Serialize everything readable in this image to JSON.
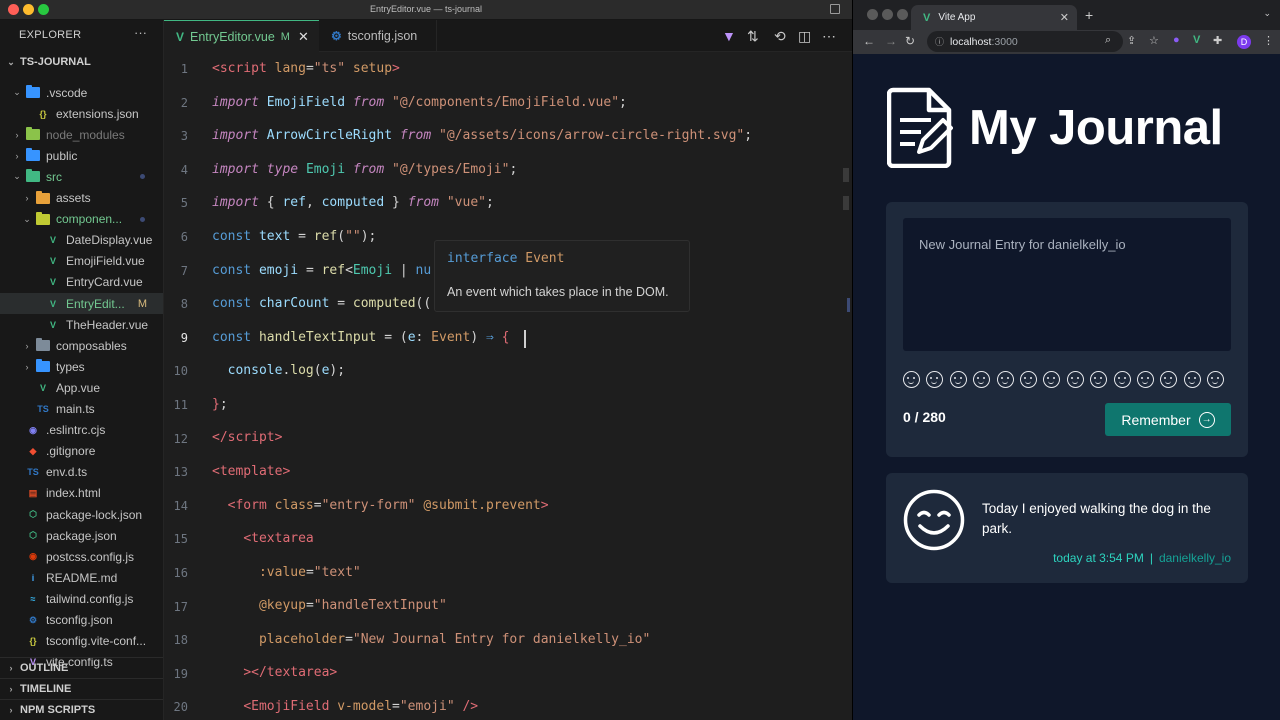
{
  "vscode": {
    "window_title": "EntryEditor.vue — ts-journal",
    "explorer": {
      "header": "EXPLORER",
      "more": "···",
      "project": "TS-JOURNAL",
      "items": [
        {
          "label": ".vscode",
          "type": "folder",
          "open": true
        },
        {
          "label": "extensions.json",
          "type": "json"
        },
        {
          "label": "node_modules",
          "type": "folder"
        },
        {
          "label": "public",
          "type": "folder"
        },
        {
          "label": "src",
          "type": "folder",
          "open": true
        },
        {
          "label": "assets",
          "type": "folder"
        },
        {
          "label": "componen...",
          "type": "folder",
          "open": true
        },
        {
          "label": "DateDisplay.vue",
          "type": "vue"
        },
        {
          "label": "EmojiField.vue",
          "type": "vue"
        },
        {
          "label": "EntryCard.vue",
          "type": "vue"
        },
        {
          "label": "EntryEdit...",
          "type": "vue",
          "badge": "M"
        },
        {
          "label": "TheHeader.vue",
          "type": "vue"
        },
        {
          "label": "composables",
          "type": "folder"
        },
        {
          "label": "types",
          "type": "folder"
        },
        {
          "label": "App.vue",
          "type": "vue"
        },
        {
          "label": "main.ts",
          "type": "ts"
        },
        {
          "label": ".eslintrc.cjs",
          "type": "eslint"
        },
        {
          "label": ".gitignore",
          "type": "git"
        },
        {
          "label": "env.d.ts",
          "type": "ts"
        },
        {
          "label": "index.html",
          "type": "html"
        },
        {
          "label": "package-lock.json",
          "type": "npm"
        },
        {
          "label": "package.json",
          "type": "npm"
        },
        {
          "label": "postcss.config.js",
          "type": "postcss"
        },
        {
          "label": "README.md",
          "type": "info"
        },
        {
          "label": "tailwind.config.js",
          "type": "tailwind"
        },
        {
          "label": "tsconfig.json",
          "type": "tsconfig"
        },
        {
          "label": "tsconfig.vite-conf...",
          "type": "json"
        },
        {
          "label": "vite.config.ts",
          "type": "vite"
        }
      ],
      "panels": [
        "OUTLINE",
        "TIMELINE",
        "NPM SCRIPTS"
      ]
    },
    "tabs": [
      {
        "label": "EntryEditor.vue",
        "modified": "M"
      },
      {
        "label": "tsconfig.json"
      }
    ],
    "line_numbers": [
      "1",
      "2",
      "3",
      "4",
      "5",
      "6",
      "7",
      "8",
      "9",
      "10",
      "11",
      "12",
      "13",
      "14",
      "15",
      "16",
      "17",
      "18",
      "19",
      "20"
    ],
    "hover": {
      "keyword": "interface",
      "name": "Event",
      "description": "An event which takes place in the DOM."
    },
    "colors": {
      "accent": "#41b883",
      "bg": "#1e1e1e",
      "sidebar": "#181818"
    }
  },
  "browser": {
    "tab_title": "Vite App",
    "url_host": "localhost",
    "url_port": ":3000",
    "nav": {
      "back": "←",
      "forward": "→",
      "reload": "↻"
    }
  },
  "app": {
    "title": "My Journal",
    "placeholder": "New Journal Entry for danielkelly_io",
    "char_count": "0 / 280",
    "remember_label": "Remember",
    "emoji_count": 14,
    "entries": [
      {
        "text": "Today I enjoyed walking the dog in the park.",
        "time": "today at 3:54 PM",
        "separator": "|",
        "user": "danielkelly_io"
      }
    ],
    "colors": {
      "bg": "#0f172a",
      "card": "#1e293b",
      "button": "#0f766e",
      "meta": "#2dd4bf"
    }
  }
}
